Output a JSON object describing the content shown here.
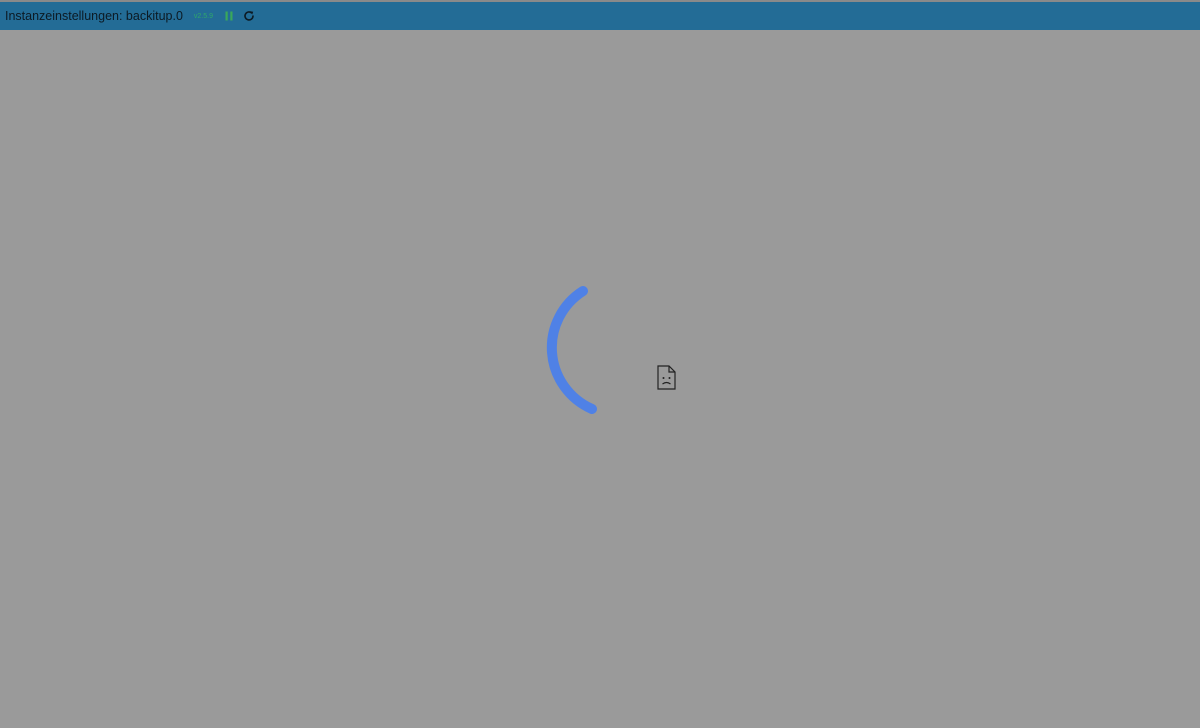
{
  "header": {
    "title": "Instanzeinstellungen: backitup.0",
    "version": "v2.5.9",
    "icons": {
      "pause": "pause-icon",
      "reload": "reload-icon"
    },
    "colors": {
      "bar": "#236c96",
      "version": "#2fa86a",
      "pause": "#3aa85a"
    }
  },
  "content": {
    "loader": "loading-spinner",
    "broken_image": "broken-image-icon",
    "spinner_color": "#4f81e6",
    "overlay_color": "#9a9a9a"
  }
}
